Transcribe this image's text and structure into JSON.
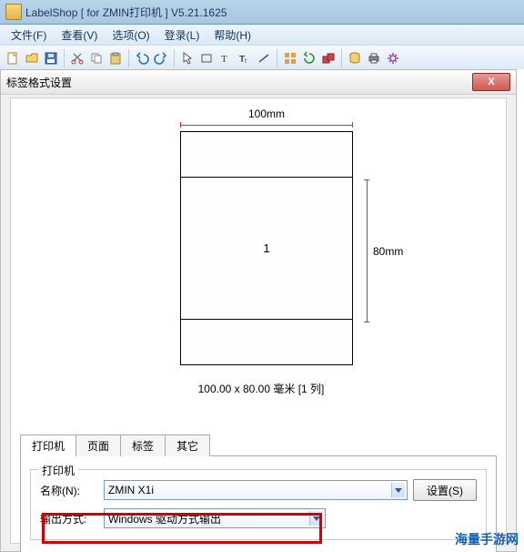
{
  "window": {
    "title": "LabelShop [ for ZMIN打印机 ] V5.21.1625"
  },
  "menu": {
    "file": "文件(F)",
    "view": "查看(V)",
    "option": "选项(O)",
    "login": "登录(L)",
    "help": "帮助(H)"
  },
  "dialog": {
    "title": "标签格式设置",
    "close": "X",
    "preview": {
      "width_label": "100mm",
      "height_label": "80mm",
      "center_text": "1",
      "size_text": "100.00 x 80.00 毫米 [1 列]"
    },
    "tabs": {
      "printer": "打印机",
      "page": "页面",
      "label": "标签",
      "other": "其它"
    },
    "printer_group": {
      "legend": "打印机",
      "name_label": "名称(N):",
      "name_value": "ZMIN X1i",
      "settings_btn": "设置(S)",
      "output_label": "输出方式:",
      "output_value": "Windows 驱动方式输出"
    }
  },
  "toolbar_icons": [
    "new",
    "open",
    "save",
    "sep",
    "cut",
    "copy",
    "paste",
    "sep",
    "undo",
    "redo",
    "sep",
    "pointer",
    "rect",
    "text",
    "t2",
    "line",
    "sep",
    "grid",
    "rotate",
    "group",
    "sep",
    "db",
    "print",
    "settings"
  ],
  "watermark": "海量手游网"
}
